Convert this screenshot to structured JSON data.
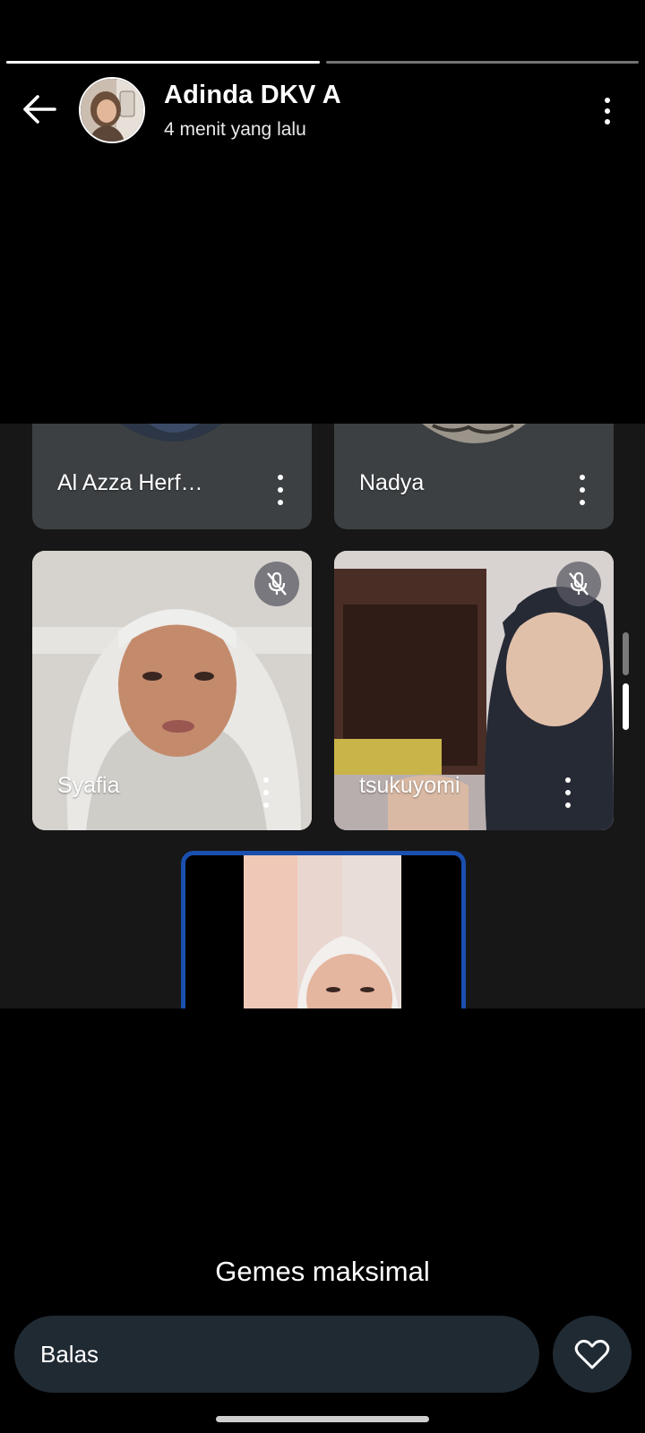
{
  "story": {
    "progress": [
      1.0,
      0.0
    ]
  },
  "header": {
    "title": "Adinda DKV A",
    "subtitle": "4 menit yang lalu"
  },
  "meet": {
    "participants": [
      {
        "name": "Al Azza Herf…",
        "mic_muted": false
      },
      {
        "name": "Nadya",
        "mic_muted": false
      },
      {
        "name": "Syafia",
        "mic_muted": true
      },
      {
        "name": "tsukuyomi",
        "mic_muted": true
      }
    ],
    "self_tile_highlight_color": "#1a4fae"
  },
  "caption": "Gemes maksimal",
  "reply": {
    "placeholder": "Balas"
  },
  "icons": {
    "back": "arrow-left-icon",
    "more": "more-vertical-icon",
    "mic_off": "mic-off-icon",
    "heart": "heart-outline-icon"
  },
  "colors": {
    "background": "#000000",
    "reply_bar": "#202a33",
    "tile_bg": "#3c4043",
    "meet_bg": "#171717"
  }
}
